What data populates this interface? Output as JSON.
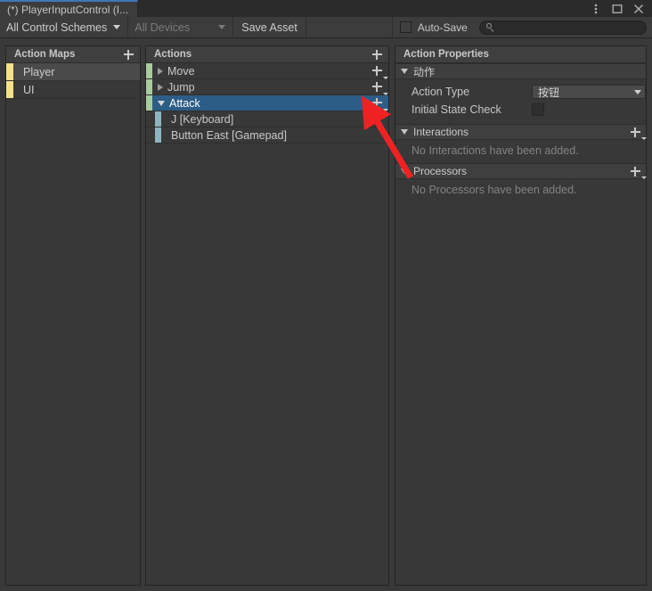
{
  "window": {
    "tab_title": "(*) PlayerInputControl (I...",
    "controls": [
      {
        "name": "more-options",
        "glyph": "kebab"
      },
      {
        "name": "maximize",
        "glyph": "square"
      },
      {
        "name": "close",
        "glyph": "cross"
      }
    ]
  },
  "toolbar": {
    "control_schemes_label": "All Control Schemes",
    "devices_label": "All Devices",
    "save_asset_label": "Save Asset",
    "auto_save_label": "Auto-Save",
    "auto_save_checked": false,
    "search_value": "",
    "search_placeholder": ""
  },
  "action_maps": {
    "header": "Action Maps",
    "add_label": "+",
    "items": [
      {
        "label": "Player",
        "selected": true,
        "color": "#f6e189"
      },
      {
        "label": "UI",
        "selected": false,
        "color": "#f6e189"
      }
    ]
  },
  "actions": {
    "header": "Actions",
    "add_label": "+",
    "items": [
      {
        "label": "Move",
        "type": "action",
        "expanded": false,
        "selected": false,
        "color": "#a9cc9b"
      },
      {
        "label": "Jump",
        "type": "action",
        "expanded": false,
        "selected": false,
        "color": "#a9cc9b"
      },
      {
        "label": "Attack",
        "type": "action",
        "expanded": true,
        "selected": true,
        "color": "#a9cc9b"
      },
      {
        "label": "J [Keyboard]",
        "type": "binding",
        "selected": false,
        "color": "#8fb4bf"
      },
      {
        "label": "Button East [Gamepad]",
        "type": "binding",
        "selected": false,
        "color": "#8fb4bf"
      }
    ]
  },
  "properties": {
    "header": "Action Properties",
    "sections": [
      {
        "title": "动作",
        "expanded": true,
        "fields": [
          {
            "label": "Action Type",
            "kind": "dropdown",
            "value": "按钮"
          },
          {
            "label": "Initial State Check",
            "kind": "checkbox",
            "checked": false
          }
        ]
      },
      {
        "title": "Interactions",
        "expanded": true,
        "empty_note": "No Interactions have been added."
      },
      {
        "title": "Processors",
        "expanded": true,
        "empty_note": "No Processors have been added."
      }
    ]
  },
  "annotation": {
    "arrow_color": "#ee2222",
    "points_at": "attack-action-add-binding-button"
  }
}
